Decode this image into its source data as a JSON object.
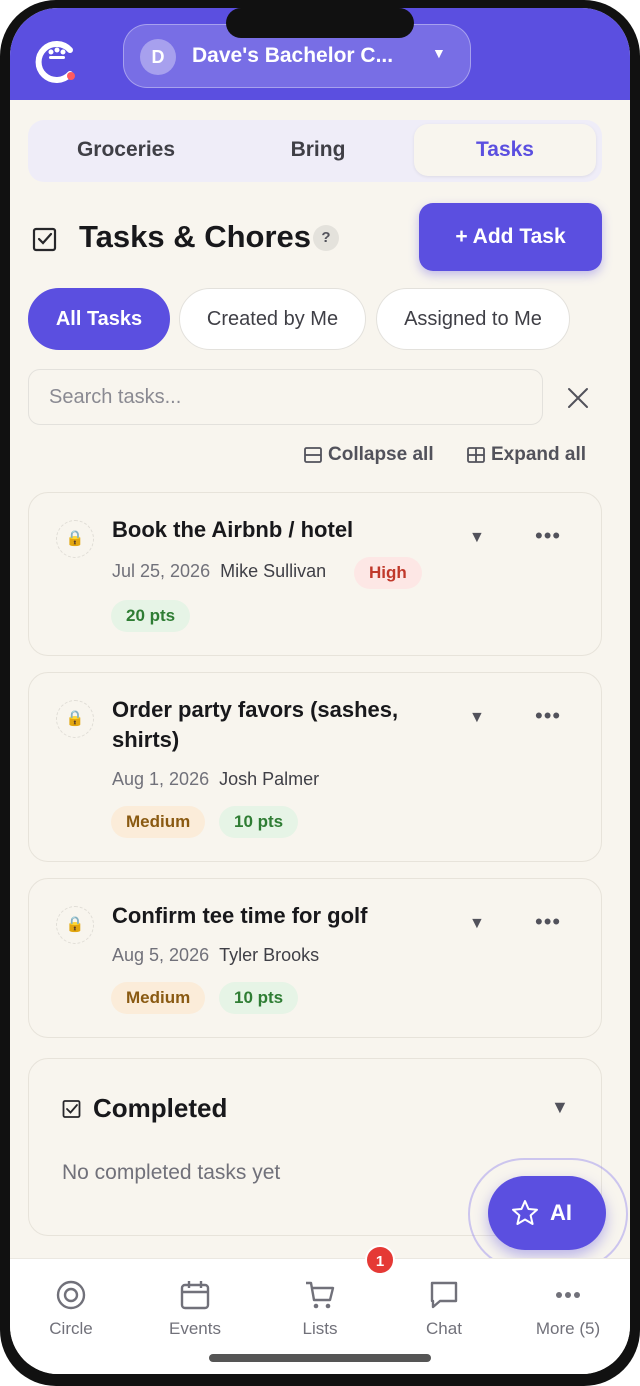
{
  "header": {
    "circle_initial": "D",
    "circle_name": "Dave's Bachelor C..."
  },
  "segments": [
    "Groceries",
    "Bring",
    "Tasks"
  ],
  "page": {
    "title": "Tasks & Chores",
    "help": "?",
    "add_button": "+ Add Task"
  },
  "filters": [
    "All Tasks",
    "Created by Me",
    "Assigned to Me"
  ],
  "search": {
    "placeholder": "Search tasks..."
  },
  "controls": {
    "collapse": "Collapse all",
    "expand": "Expand all"
  },
  "tasks": [
    {
      "title": "Book the Airbnb / hotel",
      "date": "Jul 25, 2026",
      "assignee": "Mike Sullivan",
      "priority": "High",
      "points": "20 pts"
    },
    {
      "title": "Order party favors (sashes, shirts)",
      "date": "Aug 1, 2026",
      "assignee": "Josh Palmer",
      "priority": "Medium",
      "points": "10 pts"
    },
    {
      "title": "Confirm tee time for golf",
      "date": "Aug 5, 2026",
      "assignee": "Tyler Brooks",
      "priority": "Medium",
      "points": "10 pts"
    }
  ],
  "completed": {
    "title": "Completed",
    "empty": "No completed tasks yet"
  },
  "ai": {
    "label": "AI"
  },
  "nav": {
    "items": [
      "Circle",
      "Events",
      "Lists",
      "Chat",
      "More (5)"
    ],
    "badge": "1"
  },
  "colors": {
    "accent": "#5b4fe0",
    "background": "#f8f5ee",
    "high": "#c0392b",
    "medium": "#8a5a12",
    "points": "#2f7d34"
  }
}
